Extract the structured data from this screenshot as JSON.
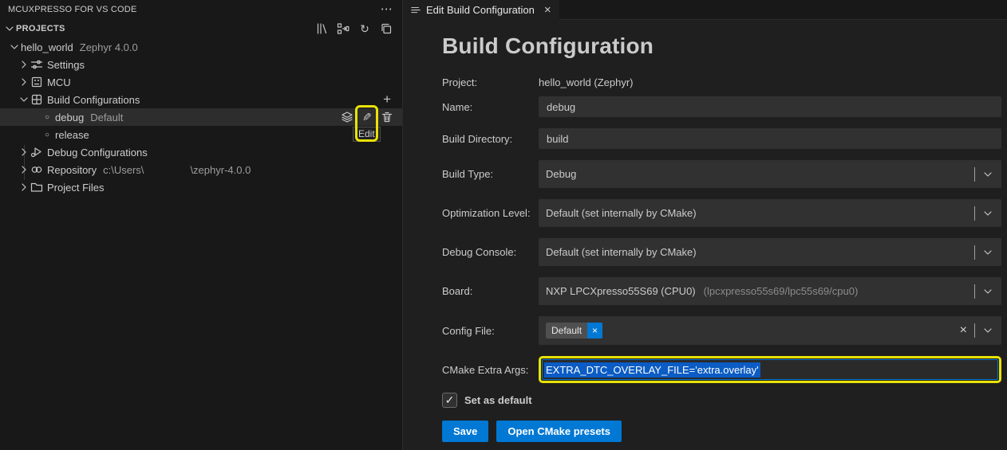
{
  "colors": {
    "accent": "#0078d4",
    "annotation_yellow": "#e9e207",
    "selection_blue": "#0b5cc4"
  },
  "icons": {
    "more": "⋯",
    "plus": "+",
    "refresh": "↻",
    "pencil": "✎",
    "circle": "○",
    "check": "✓",
    "close": "×"
  },
  "sidebar": {
    "title": "MCUXPRESSO FOR VS CODE",
    "projects": {
      "label": "PROJECTS"
    },
    "tree": {
      "project": {
        "label": "hello_world",
        "meta": "Zephyr 4.0.0"
      },
      "settings": {
        "label": "Settings"
      },
      "mcu": {
        "label": "MCU"
      },
      "build_configurations": {
        "label": "Build Configurations"
      },
      "debug": {
        "label": "debug",
        "meta": "Default",
        "tooltip": "Edit"
      },
      "release": {
        "label": "release"
      },
      "debug_configurations": {
        "label": "Debug Configurations"
      },
      "repository": {
        "label": "Repository",
        "path_prefix": "c:\\Users\\",
        "path_suffix": "\\zephyr-4.0.0"
      },
      "project_files": {
        "label": "Project Files"
      }
    }
  },
  "editor": {
    "tab": {
      "title": "Edit Build Configuration"
    },
    "heading": "Build Configuration",
    "fields": {
      "project": {
        "label": "Project:",
        "value": "hello_world (Zephyr)"
      },
      "name": {
        "label": "Name:",
        "value": "debug"
      },
      "build_directory": {
        "label": "Build Directory:",
        "value": "build"
      },
      "build_type": {
        "label": "Build Type:",
        "value": "Debug"
      },
      "optimization_level": {
        "label": "Optimization Level:",
        "value": "Default (set internally by CMake)"
      },
      "debug_console": {
        "label": "Debug Console:",
        "value": "Default (set internally by CMake)"
      },
      "board": {
        "label": "Board:",
        "value": "NXP LPCXpresso55S69 (CPU0)",
        "meta": "(lpcxpresso55s69/lpc55s69/cpu0)"
      },
      "config_file": {
        "label": "Config File:",
        "chip": "Default"
      },
      "cmake_extra_args": {
        "label": "CMake Extra Args:",
        "value": "EXTRA_DTC_OVERLAY_FILE='extra.overlay'"
      }
    },
    "set_as_default": {
      "label": "Set as default",
      "checked": true
    },
    "buttons": {
      "save": "Save",
      "open_cmake_presets": "Open CMake presets"
    }
  }
}
